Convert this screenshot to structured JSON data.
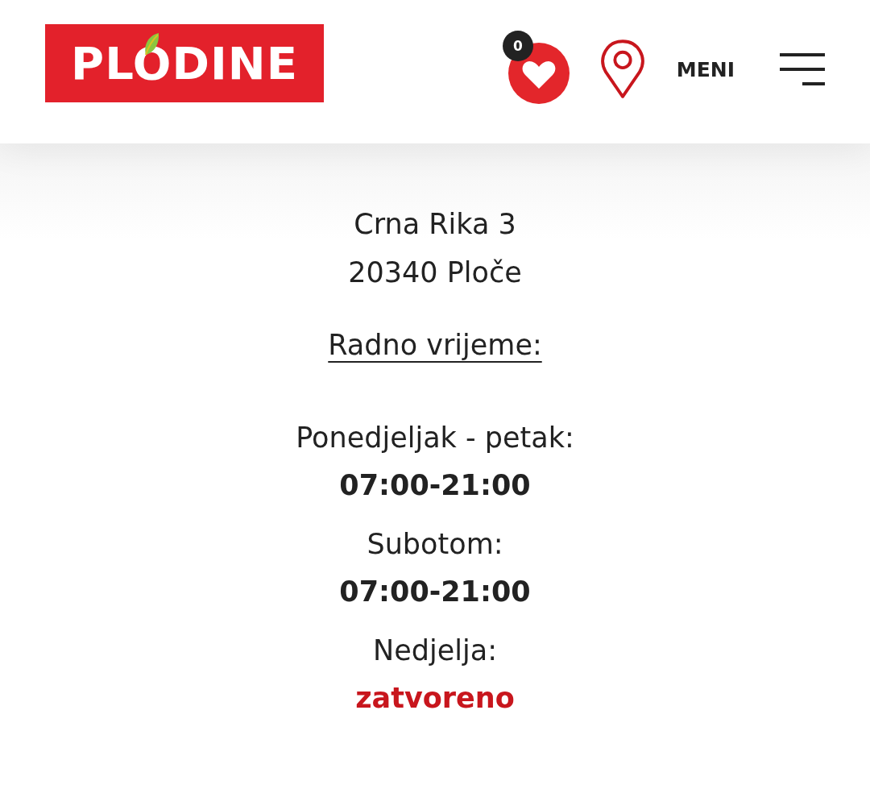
{
  "header": {
    "logo": "PLODINE",
    "favorites_count": "0",
    "menu_label": "MENI"
  },
  "address": [
    "Crna Rika 3",
    "20340 Ploče"
  ],
  "hours_title": "Radno vrijeme:",
  "hours": [
    {
      "day": "Ponedjeljak - petak:",
      "value": "07:00-21:00",
      "kind": "time"
    },
    {
      "day": "Subotom:",
      "value": "07:00-21:00",
      "kind": "time"
    },
    {
      "day": "Nedjelja:",
      "value": "zatvoreno",
      "kind": "closed"
    }
  ]
}
